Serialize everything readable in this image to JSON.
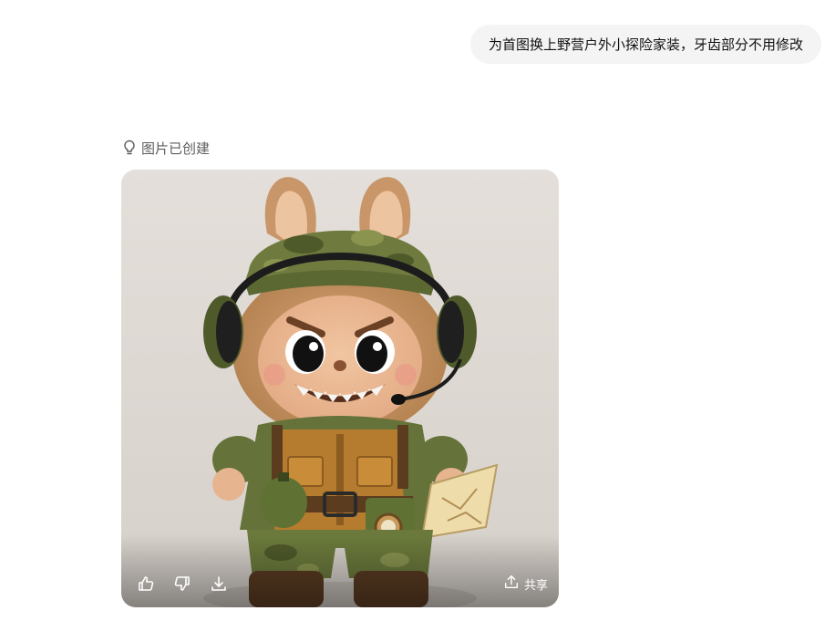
{
  "user_message": {
    "text": "为首图换上野营户外小探险家装，牙齿部分不用修改"
  },
  "assistant": {
    "status_text": "图片已创建",
    "status_icon": "lightbulb-icon",
    "image": {
      "subject": "plush-toy-explorer-image"
    },
    "actions": {
      "like_icon": "thumbs-up-icon",
      "dislike_icon": "thumbs-down-icon",
      "download_icon": "download-icon",
      "share_icon": "share-icon",
      "share_label": "共享"
    }
  }
}
